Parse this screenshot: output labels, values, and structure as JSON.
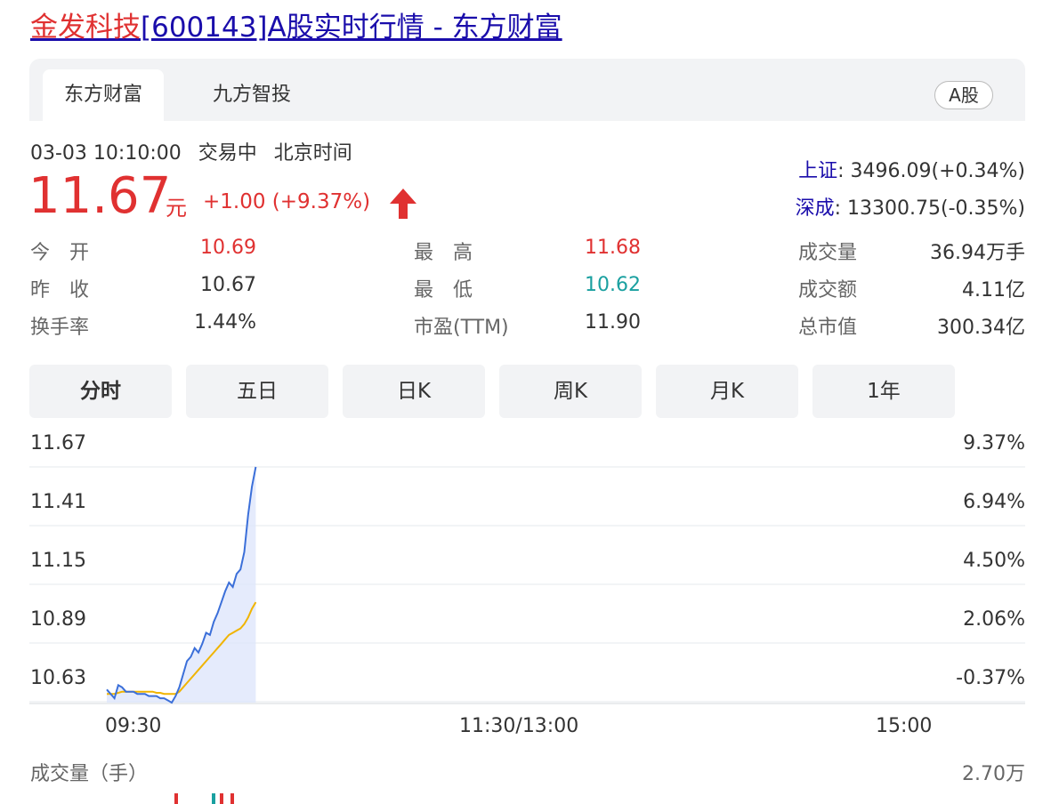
{
  "page_title": {
    "stock_name": "金发科技",
    "rest": "[600143]A股实时行情 - 东方财富"
  },
  "tabs": [
    "东方财富",
    "九方智投"
  ],
  "market_badge": "A股",
  "status": {
    "datetime": "03-03 10:10:00",
    "state": "交易中",
    "timezone": "北京时间"
  },
  "quote": {
    "price": "11.67",
    "unit": "元",
    "change": "+1.00 (+9.37%)"
  },
  "indices": [
    {
      "name": "上证",
      "value": ": 3496.09(+0.34%)"
    },
    {
      "name": "深成",
      "value": ": 13300.75(-0.35%)"
    }
  ],
  "stats": [
    {
      "label": "今　开",
      "value": "10.69",
      "tone": "red"
    },
    {
      "label": "最　高",
      "value": "11.68",
      "tone": "red"
    },
    {
      "label": "成交量",
      "value": "36.94万手",
      "tone": "normal"
    },
    {
      "label": "昨　收",
      "value": "10.67",
      "tone": "normal"
    },
    {
      "label": "最　低",
      "value": "10.62",
      "tone": "green"
    },
    {
      "label": "成交额",
      "value": "4.11亿",
      "tone": "normal"
    },
    {
      "label": "换手率",
      "value": "1.44%",
      "tone": "normal"
    },
    {
      "label": "市盈(TTM)",
      "value": "11.90",
      "tone": "normal"
    },
    {
      "label": "总市值",
      "value": "300.34亿",
      "tone": "normal"
    }
  ],
  "period_tabs": [
    "分时",
    "五日",
    "日K",
    "周K",
    "月K",
    "1年"
  ],
  "colors": {
    "up": "#e03131",
    "down": "#1aa0a0",
    "price_line": "#3b6fd9",
    "avg_line": "#f0b400",
    "area": "#dfe6fb"
  },
  "chart_data": {
    "type": "line",
    "y_ticks": [
      "11.67",
      "11.41",
      "11.15",
      "10.89",
      "10.63"
    ],
    "y_pct_ticks": [
      "9.37%",
      "6.94%",
      "4.50%",
      "2.06%",
      "-0.37%"
    ],
    "ylim": [
      10.59,
      11.67
    ],
    "x_ticks": [
      "09:30",
      "11:30/13:00",
      "15:00"
    ],
    "session_minutes": 240,
    "minutes_shown": 40,
    "series": [
      {
        "key": "price",
        "values": [
          10.65,
          10.63,
          10.61,
          10.67,
          10.66,
          10.64,
          10.64,
          10.64,
          10.63,
          10.63,
          10.63,
          10.62,
          10.62,
          10.62,
          10.61,
          10.61,
          10.6,
          10.59,
          10.62,
          10.66,
          10.72,
          10.78,
          10.8,
          10.84,
          10.82,
          10.86,
          10.91,
          10.9,
          10.96,
          11.0,
          11.05,
          11.1,
          11.14,
          11.12,
          11.18,
          11.2,
          11.28,
          11.45,
          11.58,
          11.67
        ]
      },
      {
        "key": "avg",
        "values": [
          10.63,
          10.63,
          10.63,
          10.635,
          10.64,
          10.64,
          10.64,
          10.64,
          10.64,
          10.64,
          10.64,
          10.64,
          10.64,
          10.635,
          10.635,
          10.63,
          10.63,
          10.63,
          10.63,
          10.64,
          10.66,
          10.68,
          10.7,
          10.72,
          10.74,
          10.76,
          10.78,
          10.8,
          10.82,
          10.84,
          10.86,
          10.88,
          10.9,
          10.91,
          10.92,
          10.93,
          10.95,
          10.98,
          11.02,
          11.05
        ]
      }
    ]
  },
  "volume": {
    "label": "成交量（手）",
    "max_label": "2.70万"
  }
}
